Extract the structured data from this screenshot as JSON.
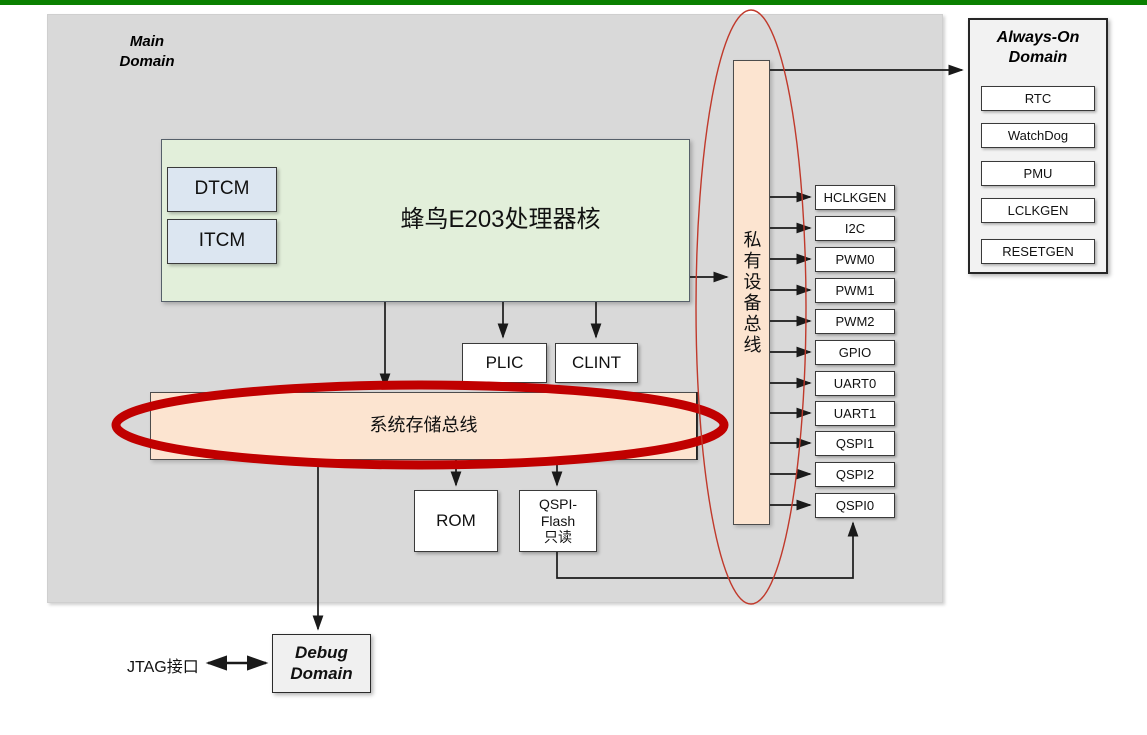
{
  "diagram": {
    "top_accent_color": "#0a8000",
    "main_domain": {
      "label": "Main\nDomain",
      "label_line1": "Main",
      "label_line2": "Domain",
      "fill": "#d9d9d9"
    },
    "core": {
      "label": "蜂鸟E203处理器核",
      "fill": "#e2efda",
      "tcm": [
        {
          "label": "DTCM"
        },
        {
          "label": "ITCM"
        }
      ]
    },
    "interrupt_units": [
      {
        "label": "PLIC"
      },
      {
        "label": "CLINT"
      }
    ],
    "system_bus": {
      "label": "系统存储总线",
      "fill": "#fce4d0",
      "highlight_color": "#c00000"
    },
    "memories": [
      {
        "label": "ROM"
      },
      {
        "label": "QSPI-\nFlash\n只读",
        "line1": "QSPI-",
        "line2": "Flash",
        "line3": "只读"
      }
    ],
    "private_bus": {
      "label": "私有设备总线",
      "fill": "#fce4d0",
      "highlight_color": "#c0392b"
    },
    "peripherals": [
      {
        "label": "HCLKGEN"
      },
      {
        "label": "I2C"
      },
      {
        "label": "PWM0"
      },
      {
        "label": "PWM1"
      },
      {
        "label": "PWM2"
      },
      {
        "label": "GPIO"
      },
      {
        "label": "UART0"
      },
      {
        "label": "UART1"
      },
      {
        "label": "QSPI1"
      },
      {
        "label": "QSPI2"
      },
      {
        "label": "QSPI0"
      }
    ],
    "always_on_domain": {
      "title_line1": "Always-On",
      "title_line2": "Domain",
      "items": [
        {
          "label": "RTC"
        },
        {
          "label": "WatchDog"
        },
        {
          "label": "PMU"
        },
        {
          "label": "LCLKGEN"
        },
        {
          "label": "RESETGEN"
        }
      ]
    },
    "debug_domain": {
      "line1": "Debug",
      "line2": "Domain"
    },
    "jtag": {
      "label": "JTAG接口"
    }
  }
}
